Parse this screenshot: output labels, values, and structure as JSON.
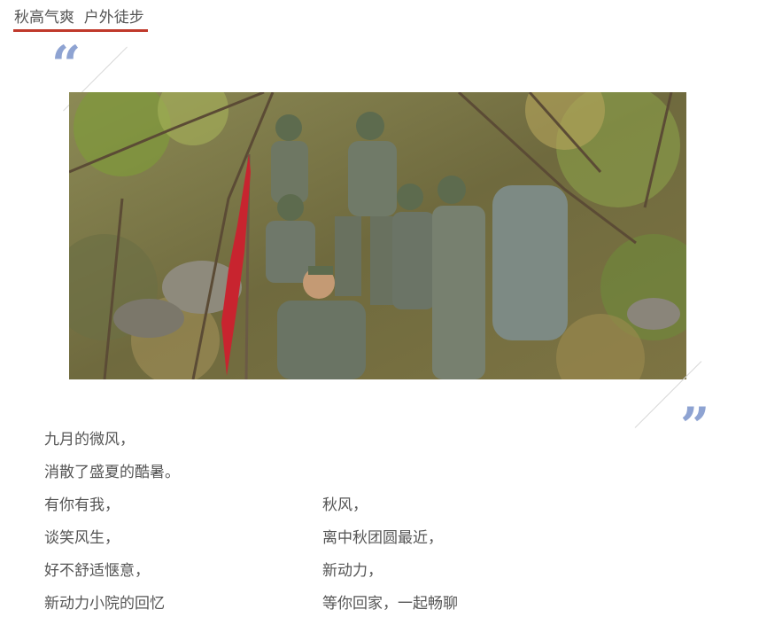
{
  "heading": {
    "title": "秋高气爽  户外徒步",
    "underline_color": "#c0392b"
  },
  "quote": {
    "open": "“",
    "close": "”",
    "color": "#8ea3d2"
  },
  "photo": {
    "subject": "group of hikers in camouflage uniforms with helmets and a red flag in autumn woods"
  },
  "poem": {
    "intro": [
      "九月的微风，",
      "消散了盛夏的酷暑。"
    ],
    "left": [
      "有你有我，",
      "谈笑风生，",
      "好不舒适惬意，",
      "新动力小院的回忆"
    ],
    "right": [
      "秋风，",
      "离中秋团圆最近，",
      "新动力，",
      "等你回家，一起畅聊"
    ]
  }
}
